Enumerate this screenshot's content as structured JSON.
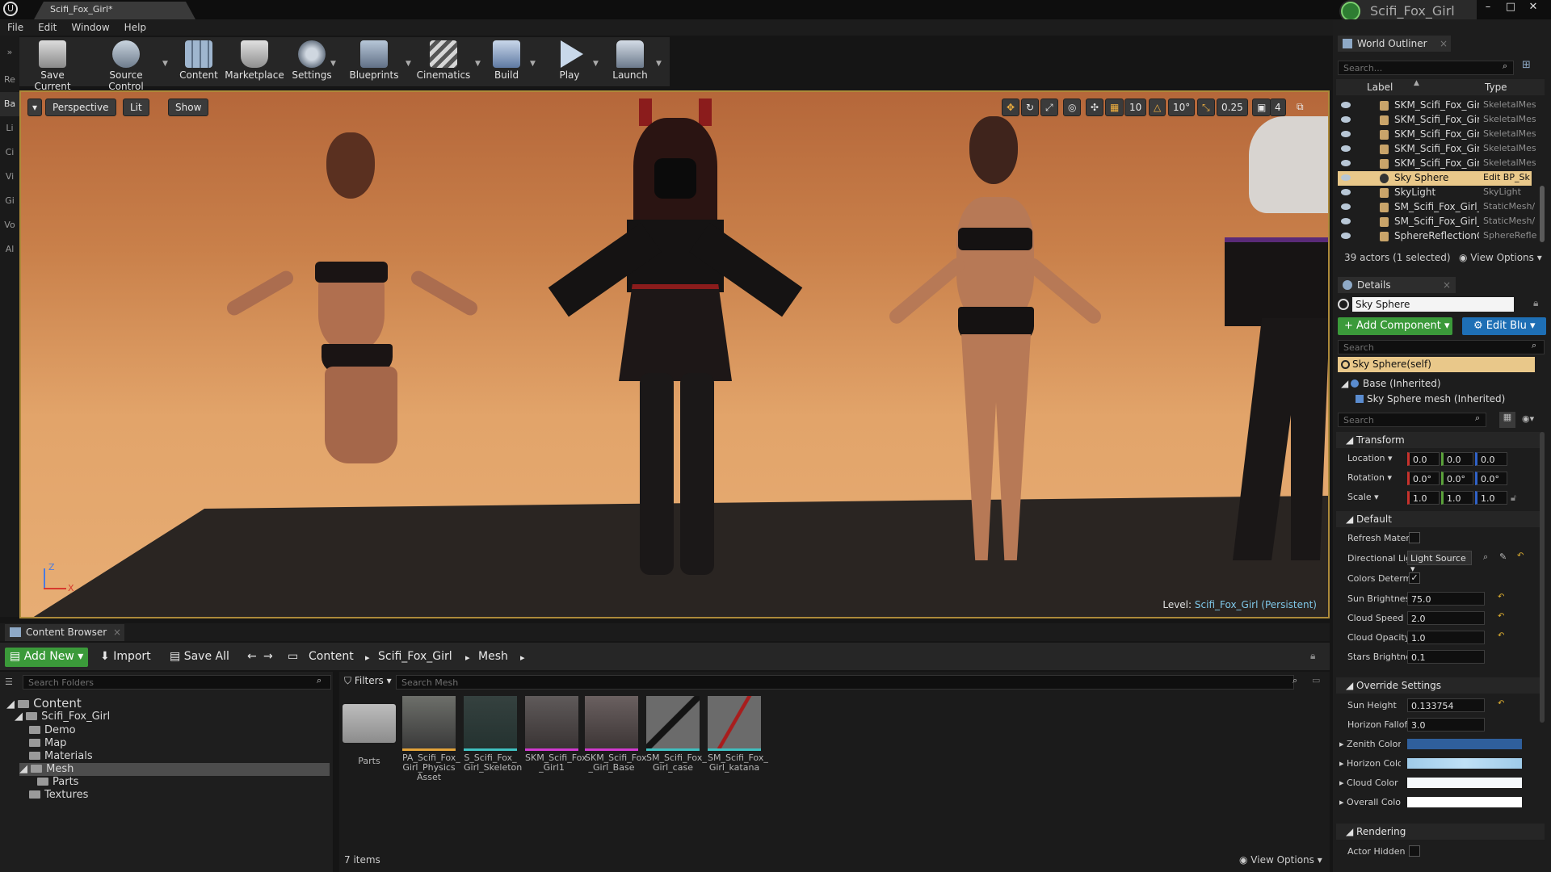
{
  "app": {
    "doc_tab": "Scifi_Fox_Girl*",
    "project_name": "Scifi_Fox_Girl",
    "window_controls": [
      "–",
      "□",
      "✕"
    ]
  },
  "menu": [
    "File",
    "Edit",
    "Window",
    "Help"
  ],
  "toolbar": [
    {
      "label": "Save Current",
      "icon": "save-icon",
      "dropdown": false
    },
    {
      "label": "Source Control",
      "icon": "source-control-icon",
      "dropdown": true
    },
    {
      "label": "Content",
      "icon": "content-icon",
      "dropdown": false
    },
    {
      "label": "Marketplace",
      "icon": "marketplace-icon",
      "dropdown": false
    },
    {
      "label": "Settings",
      "icon": "settings-icon",
      "dropdown": true
    },
    {
      "label": "Blueprints",
      "icon": "blueprints-icon",
      "dropdown": true
    },
    {
      "label": "Cinematics",
      "icon": "cinematics-icon",
      "dropdown": true
    },
    {
      "label": "Build",
      "icon": "build-icon",
      "dropdown": true
    },
    {
      "label": "Play",
      "icon": "play-icon",
      "dropdown": true
    },
    {
      "label": "Launch",
      "icon": "launch-icon",
      "dropdown": true
    }
  ],
  "left_rail": [
    "Re",
    "Ba",
    "Li",
    "Ci",
    "Vi",
    "Gi",
    "Vo",
    "Al"
  ],
  "viewport": {
    "perspective": "Perspective",
    "lit": "Lit",
    "show": "Show",
    "grid_snap": "10",
    "rot_snap": "10°",
    "scale_snap": "0.25",
    "camera_speed": "4",
    "level_label": "Level:",
    "level_name": "Scifi_Fox_Girl (Persistent)",
    "axis_x": "X",
    "axis_z": "Z"
  },
  "content_browser": {
    "tab": "Content Browser",
    "add_new": "Add New",
    "import": "Import",
    "save_all": "Save All",
    "breadcrumb": [
      "Content",
      "Scifi_Fox_Girl",
      "Mesh"
    ],
    "search_folders": "Search Folders",
    "filters": "Filters",
    "search_mesh": "Search Mesh",
    "tree": [
      {
        "label": "Content",
        "level": 0
      },
      {
        "label": "Scifi_Fox_Girl",
        "level": 1
      },
      {
        "label": "Demo",
        "level": 2
      },
      {
        "label": "Map",
        "level": 2
      },
      {
        "label": "Materials",
        "level": 2
      },
      {
        "label": "Mesh",
        "level": 2,
        "selected": true
      },
      {
        "label": "Parts",
        "level": 3
      },
      {
        "label": "Textures",
        "level": 2
      }
    ],
    "assets": [
      {
        "label": "Parts",
        "kind": "folder"
      },
      {
        "label": "PA_Scifi_Fox_ Girl_Physics Asset",
        "kind": "physics"
      },
      {
        "label": "S_Scifi_Fox_ Girl_Skeleton",
        "kind": "skeleton"
      },
      {
        "label": "SKM_Scifi_Fox _Girl1",
        "kind": "skeletal"
      },
      {
        "label": "SKM_Scifi_Fox _Girl_Base",
        "kind": "skeletal"
      },
      {
        "label": "SM_Scifi_Fox_ Girl_case",
        "kind": "static"
      },
      {
        "label": "SM_Scifi_Fox_ Girl_katana",
        "kind": "static"
      }
    ],
    "item_count": "7 items",
    "view_options": "View Options"
  },
  "outliner": {
    "tab": "World Outliner",
    "search": "Search...",
    "col_label": "Label",
    "col_type": "Type",
    "rows": [
      {
        "label": "SKM_Scifi_Fox_Girl_",
        "type": "SkeletalMes"
      },
      {
        "label": "SKM_Scifi_Fox_Girl_",
        "type": "SkeletalMes"
      },
      {
        "label": "SKM_Scifi_Fox_Girl_",
        "type": "SkeletalMes"
      },
      {
        "label": "SKM_Scifi_Fox_Girl_",
        "type": "SkeletalMes"
      },
      {
        "label": "SKM_Scifi_Fox_Girl_",
        "type": "SkeletalMes"
      },
      {
        "label": "Sky Sphere",
        "type": "Edit BP_Sk",
        "selected": true
      },
      {
        "label": "SkyLight",
        "type": "SkyLight"
      },
      {
        "label": "SM_Scifi_Fox_Girl_c",
        "type": "StaticMesh/"
      },
      {
        "label": "SM_Scifi_Fox_Girl_k",
        "type": "StaticMesh/"
      },
      {
        "label": "SphereReflectionCa",
        "type": "SphereRefle"
      }
    ],
    "actor_count": "39 actors (1 selected)",
    "view_options": "View Options"
  },
  "details": {
    "tab": "Details",
    "name": "Sky Sphere",
    "add_component": "Add Component",
    "edit_blueprint": "Edit Blu",
    "search": "Search",
    "self": "Sky Sphere(self)",
    "base": "Base (Inherited)",
    "mesh": "Sky Sphere mesh (Inherited)",
    "search2": "Search",
    "transform": {
      "title": "Transform",
      "location_label": "Location",
      "rotation_label": "Rotation",
      "scale_label": "Scale",
      "location": [
        "0.0",
        "0.0",
        "0.0"
      ],
      "rotation": [
        "0.0°",
        "0.0°",
        "0.0°"
      ],
      "scale": [
        "1.0",
        "1.0",
        "1.0"
      ]
    },
    "default": {
      "title": "Default",
      "refresh_label": "Refresh Mater",
      "dirlight_label": "Directional Lig",
      "dirlight_value": "Light Source",
      "colors_label": "Colors Determ",
      "sun_brightness_label": "Sun Brightnes",
      "sun_brightness": "75.0",
      "cloud_speed_label": "Cloud Speed",
      "cloud_speed": "2.0",
      "cloud_opacity_label": "Cloud Opacity",
      "cloud_opacity": "1.0",
      "stars_label": "Stars Brightne",
      "stars": "0.1"
    },
    "override": {
      "title": "Override Settings",
      "sun_height_label": "Sun Height",
      "sun_height": "0.133754",
      "horizon_falloff_label": "Horizon Fallof",
      "horizon_falloff": "3.0",
      "zenith_label": "Zenith Color",
      "horizon_label": "Horizon Color",
      "cloud_label": "Cloud Color",
      "overall_label": "Overall Color",
      "zenith_color": "#2f5f9c",
      "horizon_color": "#bfe0f6",
      "cloud_color": "#f5f8fb",
      "overall_color": "#ffffff"
    },
    "rendering": {
      "title": "Rendering",
      "actor_hidden_label": "Actor Hidden I"
    }
  },
  "colors": {
    "accent_green": "#3b9a3a",
    "accent_blue": "#1e6fb5",
    "selected_row": "#e9c88a",
    "viewport_border": "#ad8a3a"
  }
}
